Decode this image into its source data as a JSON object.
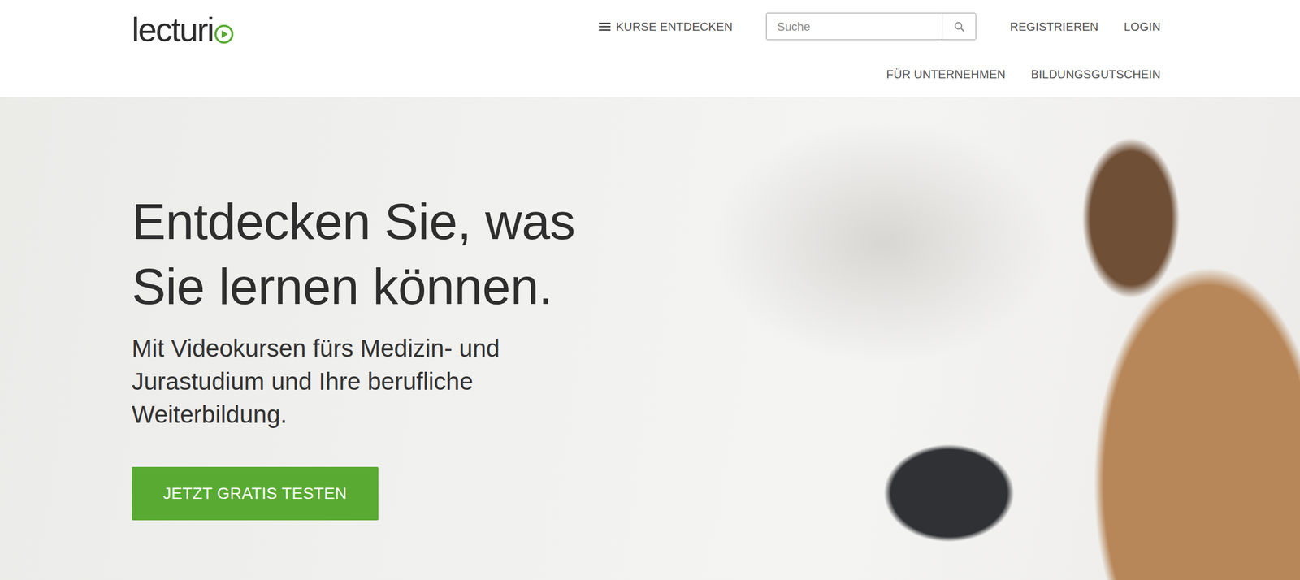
{
  "logo": {
    "text": "lecturi"
  },
  "nav": {
    "primary": [
      {
        "label": "KURSE ENTDECKEN"
      }
    ],
    "auth": [
      {
        "label": "REGISTRIEREN"
      },
      {
        "label": "LOGIN"
      }
    ],
    "secondary": [
      {
        "label": "FÜR UNTERNEHMEN"
      },
      {
        "label": "BILDUNGSGUTSCHEIN"
      }
    ]
  },
  "search": {
    "placeholder": "Suche"
  },
  "hero": {
    "title": "Entdecken Sie, was Sie lernen können.",
    "subtitle": "Mit Videokursen fürs Medizin- und Jurastudium und Ihre berufliche Weiterbildung.",
    "cta": "JETZT GRATIS TESTEN"
  }
}
